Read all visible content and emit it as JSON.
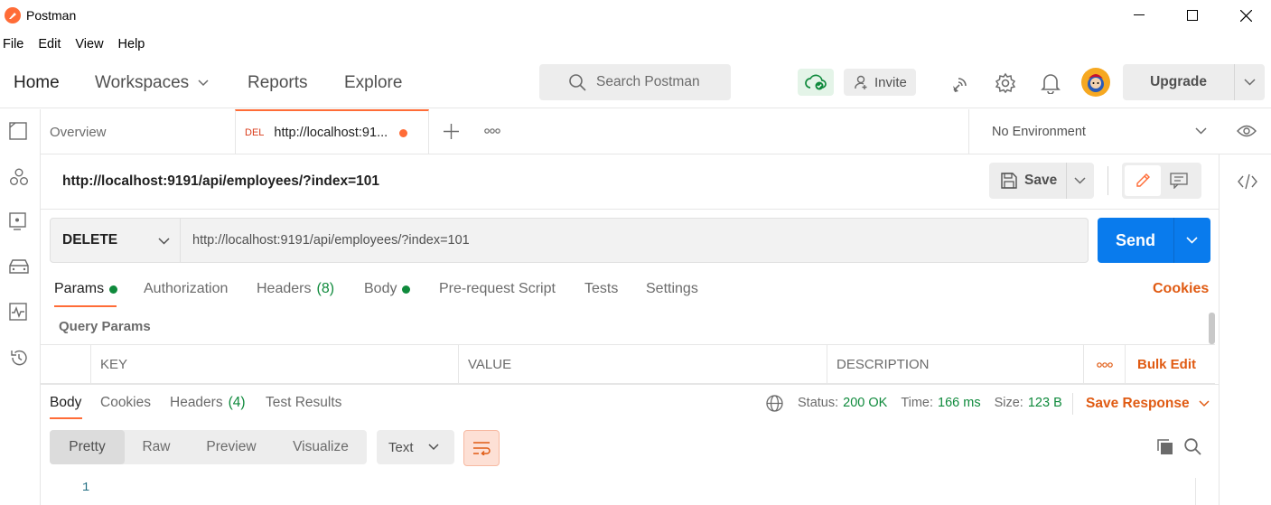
{
  "window": {
    "title": "Postman",
    "controls": [
      "minimize",
      "maximize",
      "close"
    ]
  },
  "menu": [
    "File",
    "Edit",
    "View",
    "Help"
  ],
  "header": {
    "nav": {
      "home": "Home",
      "workspaces": "Workspaces",
      "reports": "Reports",
      "explore": "Explore"
    },
    "search_placeholder": "Search Postman",
    "invite_label": "Invite",
    "upgrade_label": "Upgrade"
  },
  "sidebar_icons": [
    "collections-icon",
    "apis-icon",
    "environments-icon",
    "mock-servers-icon",
    "monitors-icon",
    "history-icon"
  ],
  "tabs": {
    "overview_label": "Overview",
    "active": {
      "method_badge": "DEL",
      "title": "http://localhost:91...",
      "unsaved": true
    },
    "environment_label": "No Environment"
  },
  "request": {
    "name": "http://localhost:9191/api/employees/?index=101",
    "save_label": "Save",
    "method": "DELETE",
    "url": "http://localhost:9191/api/employees/?index=101",
    "send_label": "Send"
  },
  "request_tabs": {
    "params": "Params",
    "authorization": "Authorization",
    "headers": "Headers",
    "headers_count": "(8)",
    "body": "Body",
    "pre_request": "Pre-request Script",
    "tests": "Tests",
    "settings": "Settings",
    "cookies": "Cookies"
  },
  "query_params": {
    "label": "Query Params",
    "columns": [
      "KEY",
      "VALUE",
      "DESCRIPTION"
    ],
    "bulk_edit": "Bulk Edit"
  },
  "response": {
    "tabs": {
      "body": "Body",
      "cookies": "Cookies",
      "headers": "Headers",
      "headers_count": "(4)",
      "test_results": "Test Results"
    },
    "status_label": "Status:",
    "status_value": "200 OK",
    "time_label": "Time:",
    "time_value": "166 ms",
    "size_label": "Size:",
    "size_value": "123 B",
    "save_response": "Save Response",
    "views": [
      "Pretty",
      "Raw",
      "Preview",
      "Visualize"
    ],
    "format": "Text",
    "line_number": "1"
  },
  "colors": {
    "accent": "#ff6c37",
    "send": "#097bed",
    "success": "#0f8a3c",
    "link": "#e05b13"
  }
}
